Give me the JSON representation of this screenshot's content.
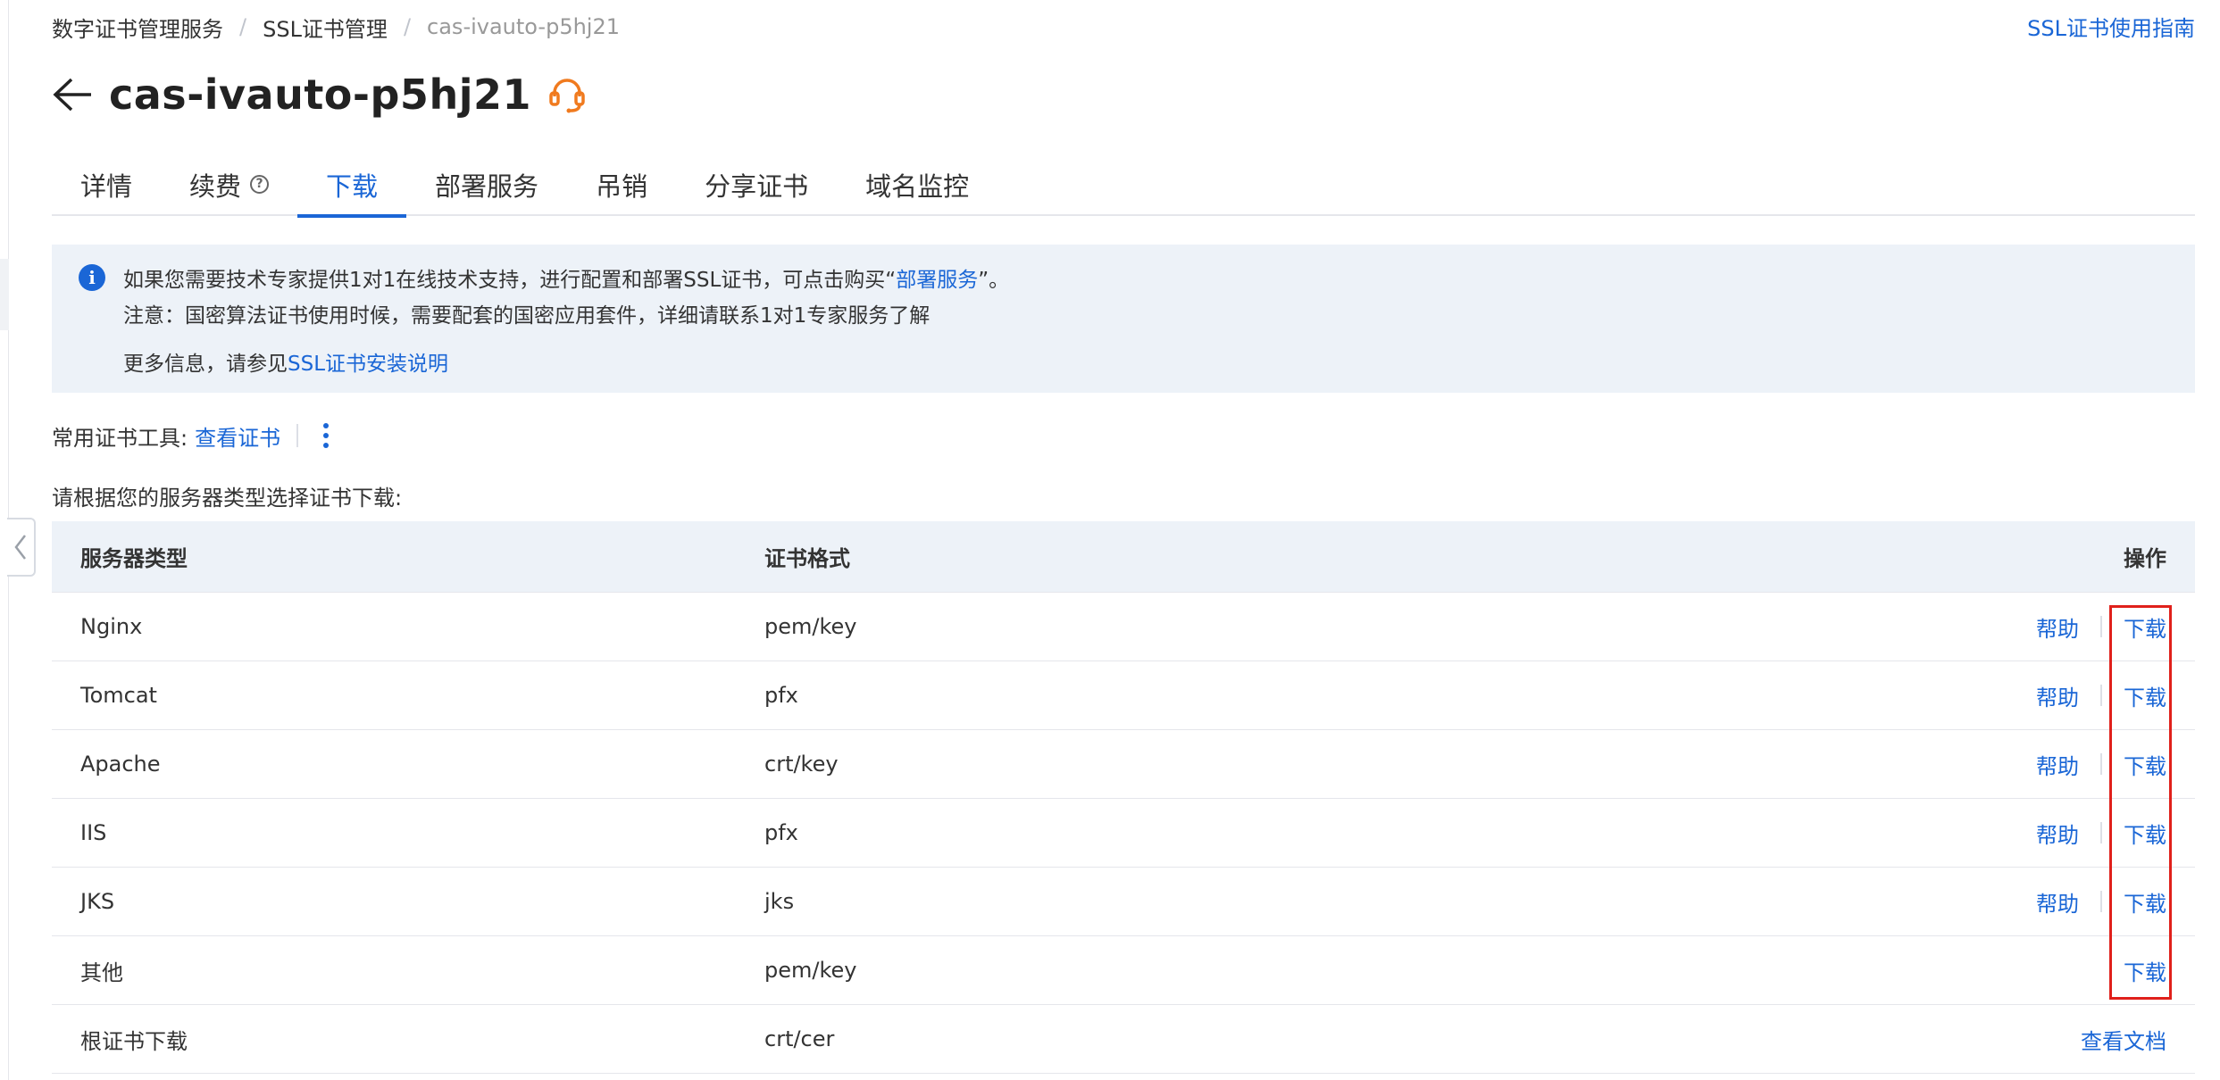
{
  "breadcrumb": {
    "items": [
      "数字证书管理服务",
      "SSL证书管理",
      "cas-ivauto-p5hj21"
    ],
    "separator": "/"
  },
  "header": {
    "guide_link": "SSL证书使用指南",
    "title": "cas-ivauto-p5hj21",
    "back_icon": "arrow-left-icon",
    "support_icon": "headset-icon"
  },
  "tabs": [
    {
      "label": "详情",
      "active": false
    },
    {
      "label": "续费",
      "active": false,
      "has_help": true
    },
    {
      "label": "下载",
      "active": true
    },
    {
      "label": "部署服务",
      "active": false
    },
    {
      "label": "吊销",
      "active": false
    },
    {
      "label": "分享证书",
      "active": false
    },
    {
      "label": "域名监控",
      "active": false
    }
  ],
  "notice": {
    "line1_prefix": "如果您需要技术专家提供1对1在线技术支持，进行配置和部署SSL证书，可点击购买“",
    "line1_link": "部署服务",
    "line1_suffix": "”。",
    "line2": "注意：国密算法证书使用时候，需要配套的国密应用套件，详细请联系1对1专家服务了解",
    "line3_prefix": "更多信息，请参见",
    "line3_link": "SSL证书安装说明"
  },
  "tools": {
    "label": "常用证书工具:",
    "link": "查看证书"
  },
  "instruction": "请根据您的服务器类型选择证书下载:",
  "table": {
    "headers": {
      "server_type": "服务器类型",
      "format": "证书格式",
      "action": "操作"
    },
    "rows": [
      {
        "server_type": "Nginx",
        "format": "pem/key",
        "help": "帮助",
        "download": "下载"
      },
      {
        "server_type": "Tomcat",
        "format": "pfx",
        "help": "帮助",
        "download": "下载"
      },
      {
        "server_type": "Apache",
        "format": "crt/key",
        "help": "帮助",
        "download": "下载"
      },
      {
        "server_type": "IIS",
        "format": "pfx",
        "help": "帮助",
        "download": "下载"
      },
      {
        "server_type": "JKS",
        "format": "jks",
        "help": "帮助",
        "download": "下载"
      },
      {
        "server_type": "其他",
        "format": "pem/key",
        "help": "",
        "download": "下载"
      },
      {
        "server_type": "根证书下载",
        "format": "crt/cer",
        "help": "",
        "download": "",
        "doc_link": "查看文档"
      }
    ]
  },
  "colors": {
    "accent": "#1a66d6",
    "support_icon": "#f07a1e",
    "highlight": "#e0201b",
    "panel_bg": "#edf2f8"
  }
}
